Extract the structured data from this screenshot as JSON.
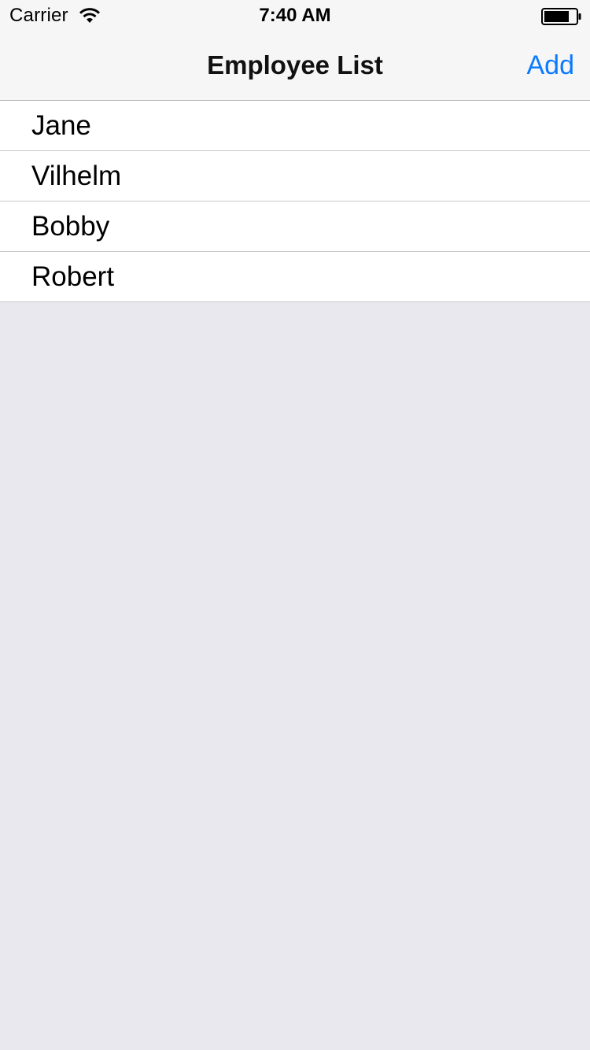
{
  "status_bar": {
    "carrier": "Carrier",
    "time": "7:40 AM"
  },
  "nav_bar": {
    "title": "Employee List",
    "add_label": "Add",
    "accent_color": "#0a7aff"
  },
  "employees": [
    {
      "name": "Jane"
    },
    {
      "name": "Vilhelm"
    },
    {
      "name": "Bobby"
    },
    {
      "name": "Robert"
    }
  ],
  "icons": {
    "signal": "wifi-icon",
    "battery": "battery-icon"
  }
}
